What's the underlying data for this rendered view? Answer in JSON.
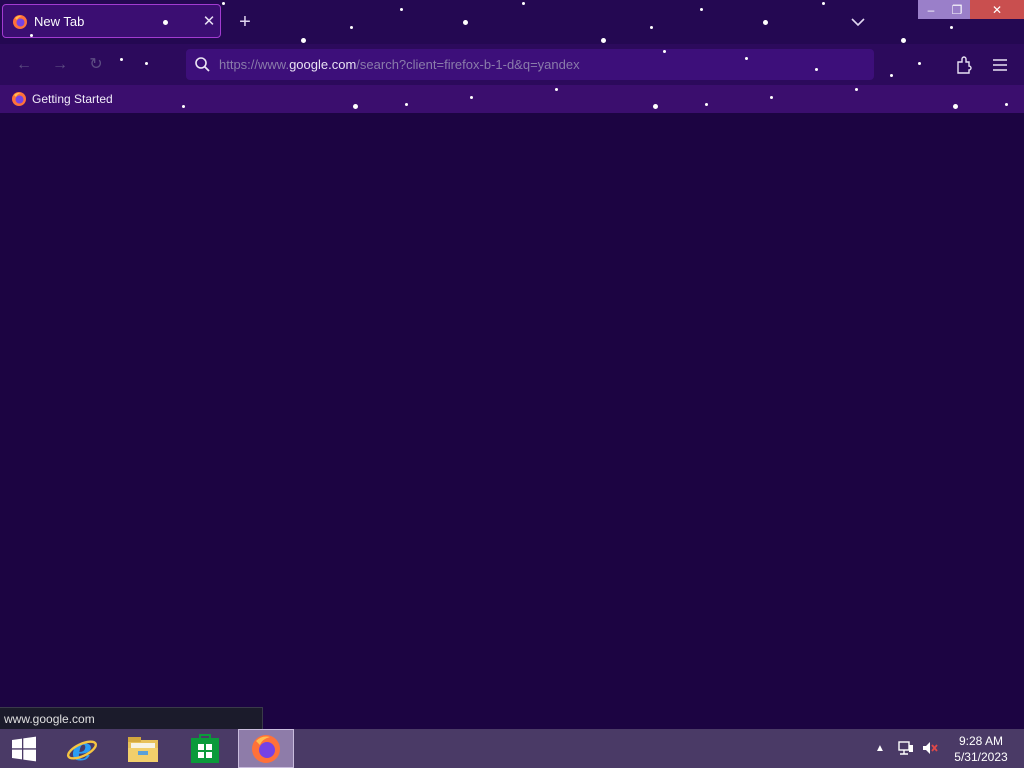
{
  "browser": {
    "tab": {
      "title": "New Tab",
      "favicon": "firefox-icon"
    },
    "new_tab_icon": "+",
    "close_tab_icon": "✕",
    "window": {
      "minimize": "–",
      "maximize": "❐",
      "close": "✕"
    },
    "nav": {
      "back": "←",
      "forward": "→",
      "reload": "↻"
    },
    "urlbar": {
      "prefix": "https://www.",
      "domain": "google.com",
      "suffix": "/search?client=firefox-b-1-d&q=yandex"
    },
    "bookmarks": [
      {
        "label": "Getting Started",
        "icon": "firefox-icon"
      }
    ],
    "status_link": "www.google.com"
  },
  "taskbar": {
    "apps": [
      {
        "name": "Internet Explorer",
        "icon": "internet-explorer-icon"
      },
      {
        "name": "File Explorer",
        "icon": "file-explorer-icon"
      },
      {
        "name": "Store",
        "icon": "store-icon"
      },
      {
        "name": "Firefox",
        "icon": "firefox-icon",
        "active": true
      }
    ],
    "tray_arrow": "▲",
    "clock": {
      "time": "9:28 AM",
      "date": "5/31/2023"
    }
  },
  "colors": {
    "background": "#1c0442",
    "titlebar": "#240852",
    "toolbar": "#2c0a5c",
    "urlbar": "#3d0f7a",
    "tab_border": "#a23bd1",
    "taskbar": "#4a3a66",
    "close_button": "#c94f4f"
  }
}
